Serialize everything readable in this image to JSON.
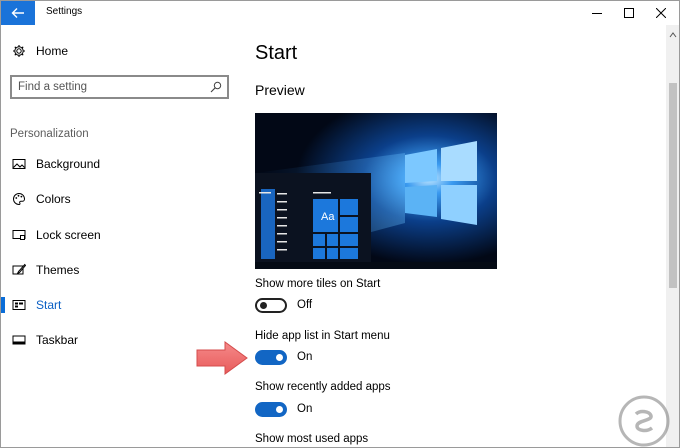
{
  "window": {
    "title": "Settings",
    "colors": {
      "accent": "#0a6dd8",
      "back_button": "#1a73d9",
      "toggle_on": "#1266c4",
      "arrow": "#f07070"
    }
  },
  "sidebar": {
    "home_label": "Home",
    "search": {
      "placeholder": "Find a setting",
      "value": ""
    },
    "section_label": "Personalization",
    "items": [
      {
        "label": "Background",
        "icon": "image-icon"
      },
      {
        "label": "Colors",
        "icon": "palette-icon"
      },
      {
        "label": "Lock screen",
        "icon": "lock-screen-icon"
      },
      {
        "label": "Themes",
        "icon": "brush-icon"
      },
      {
        "label": "Start",
        "icon": "start-icon",
        "active": true
      },
      {
        "label": "Taskbar",
        "icon": "taskbar-icon"
      }
    ]
  },
  "main": {
    "title": "Start",
    "preview_heading": "Preview",
    "preview": {
      "tile_text": "Aa"
    },
    "settings": [
      {
        "label": "Show more tiles on Start",
        "state": "Off"
      },
      {
        "label": "Hide app list in Start menu",
        "state": "On"
      },
      {
        "label": "Show recently added apps",
        "state": "On"
      },
      {
        "label": "Show most used apps",
        "state": ""
      }
    ]
  }
}
